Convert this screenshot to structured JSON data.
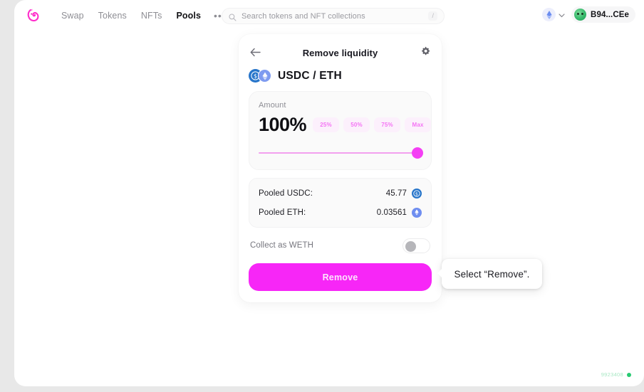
{
  "header": {
    "logo_icon": "unicorn-logo",
    "nav": [
      {
        "label": "Swap",
        "active": false
      },
      {
        "label": "Tokens",
        "active": false
      },
      {
        "label": "NFTs",
        "active": false
      },
      {
        "label": "Pools",
        "active": true
      }
    ],
    "more_label": "•••",
    "search": {
      "placeholder": "Search tokens and NFT collections",
      "icon": "search-icon",
      "shortcut": "/"
    },
    "network": {
      "icon": "ethereum-icon",
      "chevron": "chevron-down-icon"
    },
    "wallet": {
      "address": "B94...CEe",
      "avatar": "frog-avatar"
    }
  },
  "card": {
    "back_icon": "back-arrow-icon",
    "title": "Remove liquidity",
    "settings_icon": "gear-icon",
    "pair": {
      "label": "USDC / ETH",
      "token0_icon": "usdc-icon",
      "token1_icon": "eth-icon"
    },
    "amount": {
      "label": "Amount",
      "value": "100%",
      "presets": [
        "25%",
        "50%",
        "75%",
        "Max"
      ],
      "slider_percent": 100
    },
    "pooled": [
      {
        "label": "Pooled USDC:",
        "value": "45.77",
        "icon": "usdc-icon"
      },
      {
        "label": "Pooled ETH:",
        "value": "0.03561",
        "icon": "eth-icon"
      }
    ],
    "collect": {
      "label": "Collect as WETH",
      "toggle_on": false
    },
    "remove_label": "Remove"
  },
  "tooltip": {
    "text": "Select “Remove”."
  },
  "status": {
    "block_number": "9923408",
    "dot_color": "#27ca71"
  },
  "colors": {
    "accent": "#f726f7",
    "accent_light": "#fcf0fc",
    "slider_track": "#f3a0ef",
    "usdc": "#2775ca",
    "eth": "#7e9bf0"
  }
}
